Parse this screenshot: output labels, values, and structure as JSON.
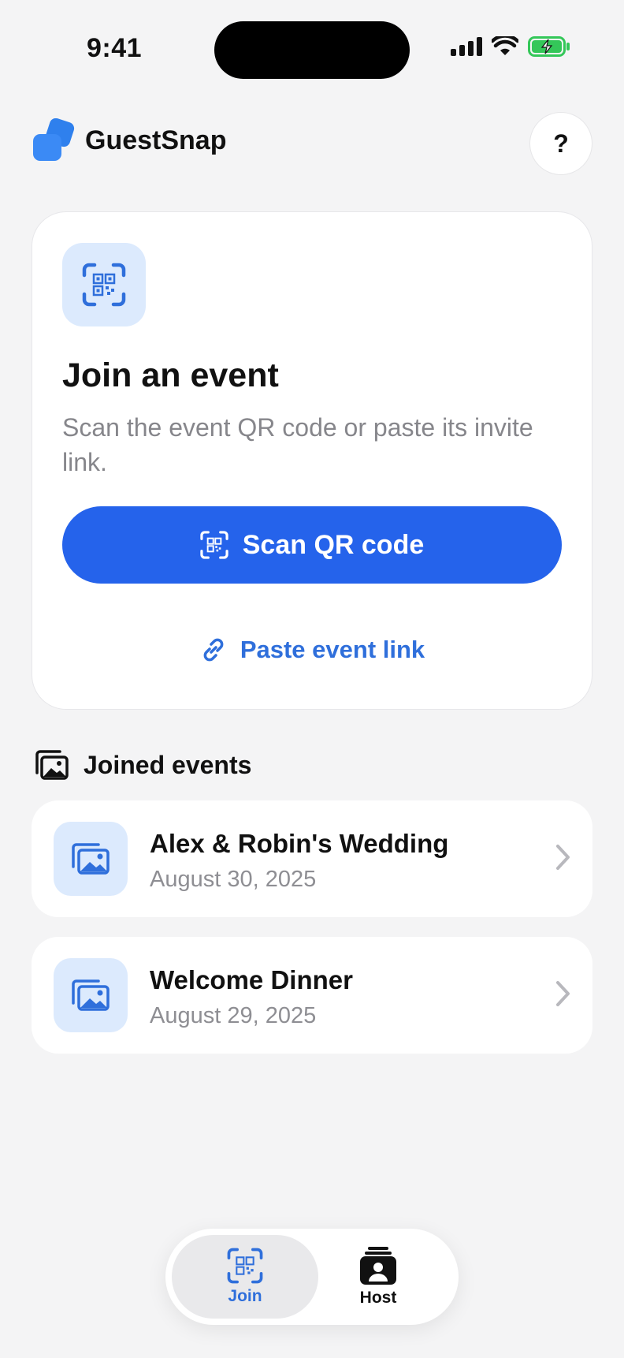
{
  "status_bar": {
    "time": "9:41"
  },
  "header": {
    "app_name": "GuestSnap",
    "help_label": "?"
  },
  "join_card": {
    "title": "Join an event",
    "subtitle": "Scan the event QR code or paste its invite link.",
    "scan_button": "Scan QR code",
    "paste_link": "Paste event link"
  },
  "joined": {
    "title": "Joined events",
    "events": [
      {
        "name": "Alex & Robin's Wedding",
        "date": "August 30, 2025"
      },
      {
        "name": "Welcome Dinner",
        "date": "August 29, 2025"
      }
    ]
  },
  "tabbar": {
    "tabs": [
      {
        "label": "Join",
        "active": true
      },
      {
        "label": "Host",
        "active": false
      }
    ]
  },
  "colors": {
    "accent": "#2563eb",
    "accent_soft": "#dceafd",
    "link": "#2f6fdb",
    "battery": "#34c759"
  },
  "icons": [
    "signal-icon",
    "wifi-icon",
    "battery-icon",
    "logo-icon",
    "qr-scan-icon",
    "link-icon",
    "photos-icon",
    "image-stack-icon",
    "chevron-right-icon",
    "host-icon"
  ]
}
